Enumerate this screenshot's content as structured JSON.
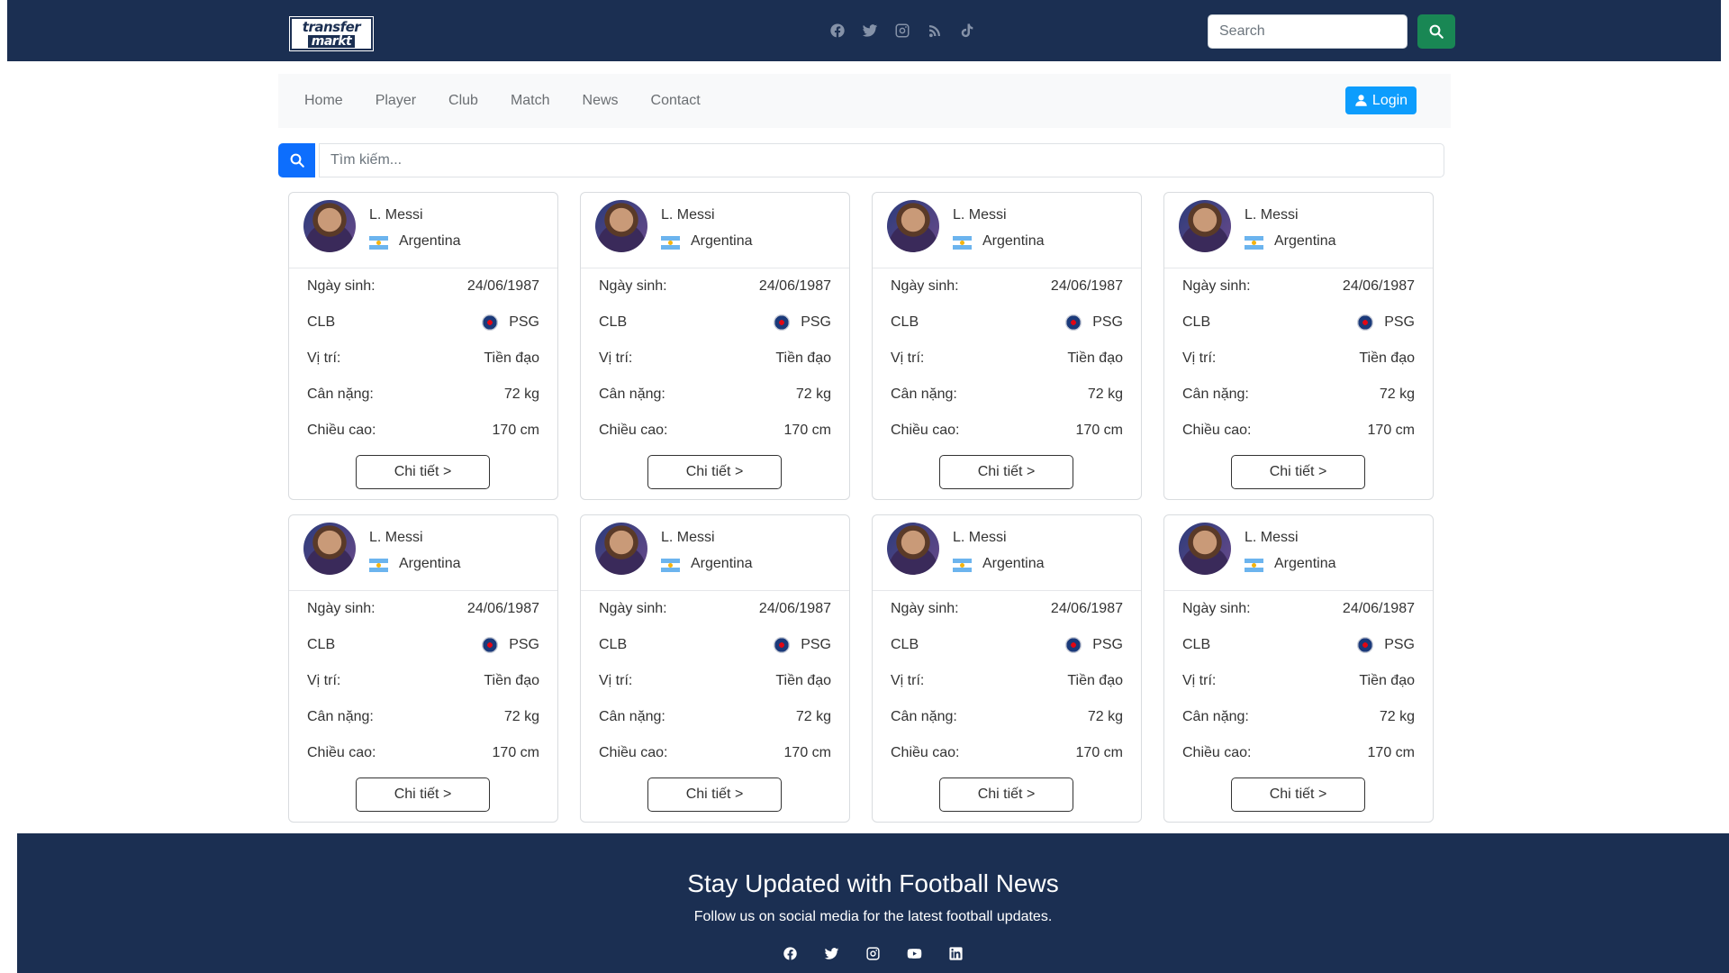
{
  "header": {
    "logo_line1": "transfer",
    "logo_line2": "markt",
    "social_icons": [
      "facebook-icon",
      "twitter-icon",
      "instagram-icon",
      "rss-icon",
      "tiktok-icon"
    ],
    "search_placeholder": "Search",
    "colors": {
      "bar": "#1b2f52",
      "search_button": "#198754"
    }
  },
  "nav": {
    "links": [
      "Home",
      "Player",
      "Club",
      "Match",
      "News",
      "Contact"
    ],
    "login_label": "Login",
    "colors": {
      "login": "#0d9dfd"
    }
  },
  "search": {
    "placeholder": "Tìm kiếm..."
  },
  "labels": {
    "dob": "Ngày sinh:",
    "club": "CLB",
    "position": "Vị trí:",
    "weight": "Cân nặng:",
    "height": "Chiều cao:",
    "detail_button": "Chi tiết >"
  },
  "players": [
    {
      "name": "L. Messi",
      "country": "Argentina",
      "dob": "24/06/1987",
      "club": "PSG",
      "position": "Tiền đạo",
      "weight": "72 kg",
      "height": "170 cm"
    },
    {
      "name": "L. Messi",
      "country": "Argentina",
      "dob": "24/06/1987",
      "club": "PSG",
      "position": "Tiền đạo",
      "weight": "72 kg",
      "height": "170 cm"
    },
    {
      "name": "L. Messi",
      "country": "Argentina",
      "dob": "24/06/1987",
      "club": "PSG",
      "position": "Tiền đạo",
      "weight": "72 kg",
      "height": "170 cm"
    },
    {
      "name": "L. Messi",
      "country": "Argentina",
      "dob": "24/06/1987",
      "club": "PSG",
      "position": "Tiền đạo",
      "weight": "72 kg",
      "height": "170 cm"
    },
    {
      "name": "L. Messi",
      "country": "Argentina",
      "dob": "24/06/1987",
      "club": "PSG",
      "position": "Tiền đạo",
      "weight": "72 kg",
      "height": "170 cm"
    },
    {
      "name": "L. Messi",
      "country": "Argentina",
      "dob": "24/06/1987",
      "club": "PSG",
      "position": "Tiền đạo",
      "weight": "72 kg",
      "height": "170 cm"
    },
    {
      "name": "L. Messi",
      "country": "Argentina",
      "dob": "24/06/1987",
      "club": "PSG",
      "position": "Tiền đạo",
      "weight": "72 kg",
      "height": "170 cm"
    },
    {
      "name": "L. Messi",
      "country": "Argentina",
      "dob": "24/06/1987",
      "club": "PSG",
      "position": "Tiền đạo",
      "weight": "72 kg",
      "height": "170 cm"
    }
  ],
  "footer": {
    "title": "Stay Updated with Football News",
    "subtitle": "Follow us on social media for the latest football updates.",
    "social_icons": [
      "facebook-icon",
      "twitter-icon",
      "instagram-icon",
      "youtube-icon",
      "linkedin-icon"
    ]
  }
}
